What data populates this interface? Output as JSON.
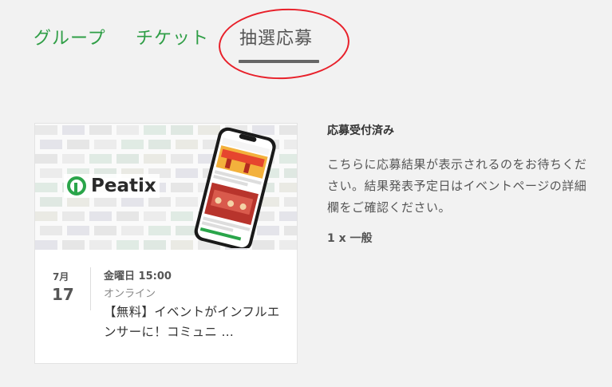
{
  "tabs": [
    {
      "label": "グループ",
      "active": false
    },
    {
      "label": "チケット",
      "active": false
    },
    {
      "label": "抽選応募",
      "active": true
    }
  ],
  "colors": {
    "tab_green": "#2f9e46",
    "annotation_red": "#e8202a",
    "background": "#f2f2f2"
  },
  "event_card": {
    "thumbnail": {
      "logo_text": "Peatix",
      "logo_icon": "peatix-p-icon"
    },
    "date": {
      "month": "7月",
      "day": "17"
    },
    "datetime": "金曜日 15:00",
    "venue": "オンライン",
    "title": "【無料】イベントがインフルエンサーに！コミュニ …"
  },
  "status": {
    "title": "応募受付済み",
    "description": "こちらに応募結果が表示されるのをお待ちください。結果発表予定日はイベントページの詳細欄をご確認ください。",
    "ticket": "1 x 一般"
  }
}
